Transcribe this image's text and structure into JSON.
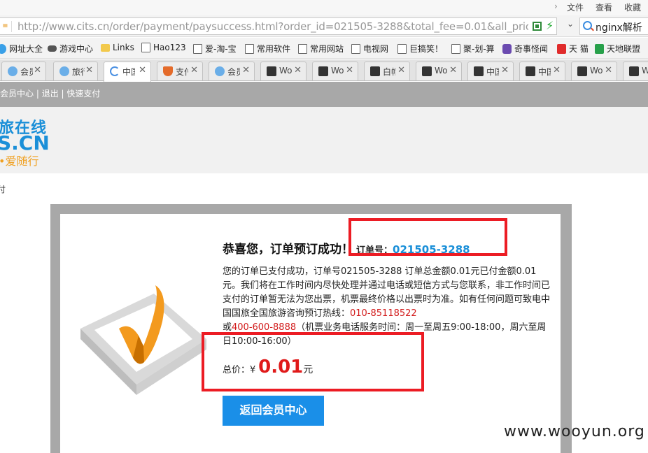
{
  "menubar": {
    "file": "文件",
    "view": "查看",
    "favorites": "收藏"
  },
  "address": {
    "url": "http://www.cits.cn/order/payment/paysuccess.html?order_id=021505-3288&total_fee=0.01&all_pric",
    "search_value": "nginx解析"
  },
  "bookmarks": [
    {
      "label": "网址大全",
      "icon": "globe-icon"
    },
    {
      "label": "游戏中心",
      "icon": "gamepad-icon"
    },
    {
      "label": "Links",
      "icon": "folder-icon"
    },
    {
      "label": "Hao123",
      "icon": "page-icon"
    },
    {
      "label": "爱-淘-宝",
      "icon": "page-icon"
    },
    {
      "label": "常用软件",
      "icon": "page-icon"
    },
    {
      "label": "常用网站",
      "icon": "page-icon"
    },
    {
      "label": "电视网",
      "icon": "page-icon"
    },
    {
      "label": "巨搞笑！",
      "icon": "page-icon"
    },
    {
      "label": "聚-划-算",
      "icon": "page-icon"
    },
    {
      "label": "奇事怪闻",
      "icon": "cat-icon"
    },
    {
      "label": "天 猫",
      "icon": "tmall-icon"
    },
    {
      "label": "天地联盟",
      "icon": "star-icon"
    }
  ],
  "tabs": [
    {
      "label": "会员",
      "icon": "globe-icon"
    },
    {
      "label": "旅行",
      "icon": "globe-icon"
    },
    {
      "label": "中国",
      "icon": "loading-icon",
      "active": true
    },
    {
      "label": "支付",
      "icon": "shield-icon"
    },
    {
      "label": "会员",
      "icon": "globe-icon"
    },
    {
      "label": "Wo",
      "icon": "wooyun-icon"
    },
    {
      "label": "Wo",
      "icon": "wooyun-icon"
    },
    {
      "label": "白帽",
      "icon": "wooyun-icon"
    },
    {
      "label": "Wo",
      "icon": "wooyun-icon"
    },
    {
      "label": "中国",
      "icon": "wooyun-icon"
    },
    {
      "label": "中国",
      "icon": "wooyun-icon"
    },
    {
      "label": "Wo",
      "icon": "wooyun-icon"
    },
    {
      "label": "W",
      "icon": "wooyun-icon"
    }
  ],
  "topnav": {
    "member_center": "会员中心",
    "logout": "退出",
    "quick_pay": "快速支付",
    "sep": " | "
  },
  "logo": {
    "line1": "旅在线",
    "line2": "S.CN",
    "line3": "•爱随行"
  },
  "breadcrumb": "付",
  "result": {
    "title": "恭喜您，订单预订成功！",
    "order_label": "订单号：",
    "order_no": "021505-3288",
    "desc_part1": "您的订单已支付成功，订单号021505-3288 订单总金额0.01元已付金额0.01元。我们将在工作时间内尽快处理并通过电话或短信方式与您联系，非工作时间已支付的订单暂无法为您出票，机票最终价格以出票时为准。如有任何问题可致电中国国旅全国旅游咨询预订热线：",
    "phone1": "010-85118522",
    "desc_or": "或",
    "phone2": "400-600-8888",
    "desc_part2": "（机票业务电话服务时间：周一至周五9:00-18:00，周六至周日10:00-16:00）",
    "total_label": "总价：",
    "currency": "¥",
    "total_value": "0.01",
    "unit": "元",
    "back_button": "返回会员中心"
  },
  "watermark": "www.wooyun.org",
  "colors": {
    "brand_blue": "#1a8fd8",
    "price_red": "#e01a1a",
    "highlight_red": "#ec1c24",
    "check_orange": "#f39a1e"
  }
}
